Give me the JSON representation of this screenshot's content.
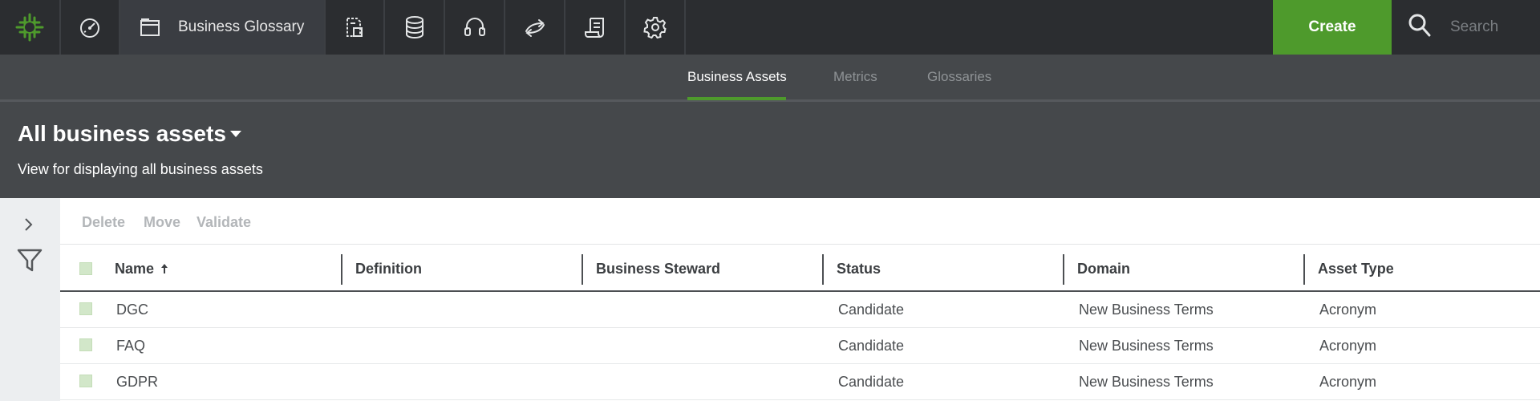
{
  "nav": {
    "items": [
      {
        "name": "dashboard",
        "icon": "speedometer-icon"
      },
      {
        "name": "business-glossary",
        "icon": "window-icon",
        "label": "Business Glossary"
      },
      {
        "name": "data-dictionary",
        "icon": "document-flow-icon"
      },
      {
        "name": "catalog",
        "icon": "database-icon"
      },
      {
        "name": "stewardship",
        "icon": "headset-icon"
      },
      {
        "name": "lineage",
        "icon": "exchange-arrows-icon"
      },
      {
        "name": "reports",
        "icon": "scroll-icon"
      },
      {
        "name": "settings",
        "icon": "gear-icon"
      }
    ],
    "create_label": "Create",
    "search_placeholder": "Search"
  },
  "tabs": [
    {
      "label": "Business Assets",
      "active": true
    },
    {
      "label": "Metrics",
      "active": false
    },
    {
      "label": "Glossaries",
      "active": false
    }
  ],
  "header": {
    "title": "All business assets",
    "subtitle": "View for displaying all business assets"
  },
  "toolbar": {
    "delete": "Delete",
    "move": "Move",
    "validate": "Validate"
  },
  "table": {
    "columns": [
      "Name",
      "Definition",
      "Business Steward",
      "Status",
      "Domain",
      "Asset Type"
    ],
    "rows": [
      {
        "name": "DGC",
        "definition": "",
        "steward": "",
        "status": "Candidate",
        "domain": "New Business Terms",
        "type": "Acronym"
      },
      {
        "name": "FAQ",
        "definition": "",
        "steward": "",
        "status": "Candidate",
        "domain": "New Business Terms",
        "type": "Acronym"
      },
      {
        "name": "GDPR",
        "definition": "",
        "steward": "",
        "status": "Candidate",
        "domain": "New Business Terms",
        "type": "Acronym"
      }
    ]
  },
  "colors": {
    "accent_green": "#4e9a2c",
    "topbar": "#2b2d30",
    "header": "#45484b"
  }
}
